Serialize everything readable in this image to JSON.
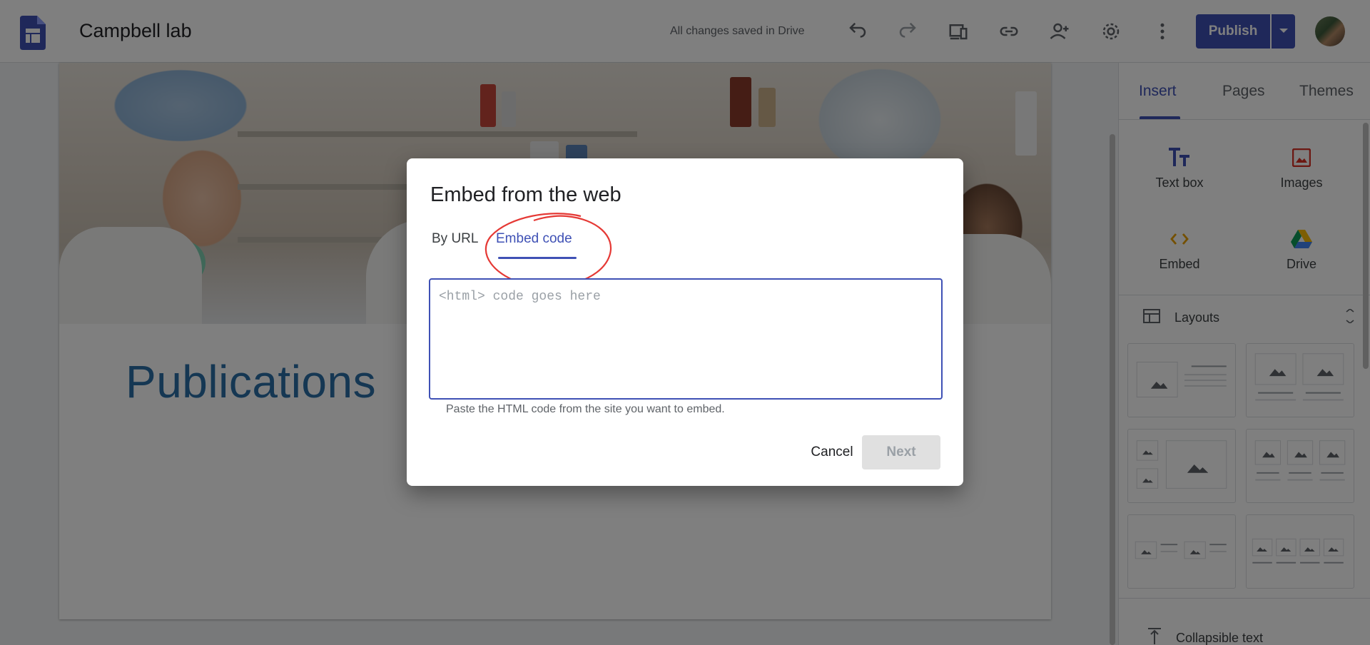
{
  "header": {
    "site_title": "Campbell lab",
    "save_status": "All changes saved in Drive",
    "publish_label": "Publish",
    "icons": [
      "undo-icon",
      "redo-icon",
      "preview-icon",
      "link-icon",
      "share-icon",
      "settings-icon",
      "more-icon"
    ]
  },
  "page": {
    "heading": "Publications"
  },
  "panel": {
    "tabs": [
      "Insert",
      "Pages",
      "Themes"
    ],
    "active_tab": "Insert",
    "insert_items": [
      {
        "label": "Text box",
        "icon": "text-box-icon"
      },
      {
        "label": "Images",
        "icon": "image-icon"
      },
      {
        "label": "Embed",
        "icon": "embed-icon"
      },
      {
        "label": "Drive",
        "icon": "drive-icon"
      }
    ],
    "layouts_label": "Layouts",
    "collapsible_label": "Collapsible text"
  },
  "dialog": {
    "title": "Embed from the web",
    "tabs": [
      "By URL",
      "Embed code"
    ],
    "active_tab": "Embed code",
    "code_placeholder": "<html> code goes here",
    "code_value": "",
    "helper_text": "Paste the HTML code from the site you want to embed.",
    "cancel_label": "Cancel",
    "next_label": "Next",
    "next_disabled": true
  },
  "colors": {
    "accent": "#3f51b5",
    "annotation": "#e53935",
    "heading": "#2a6fa7"
  }
}
